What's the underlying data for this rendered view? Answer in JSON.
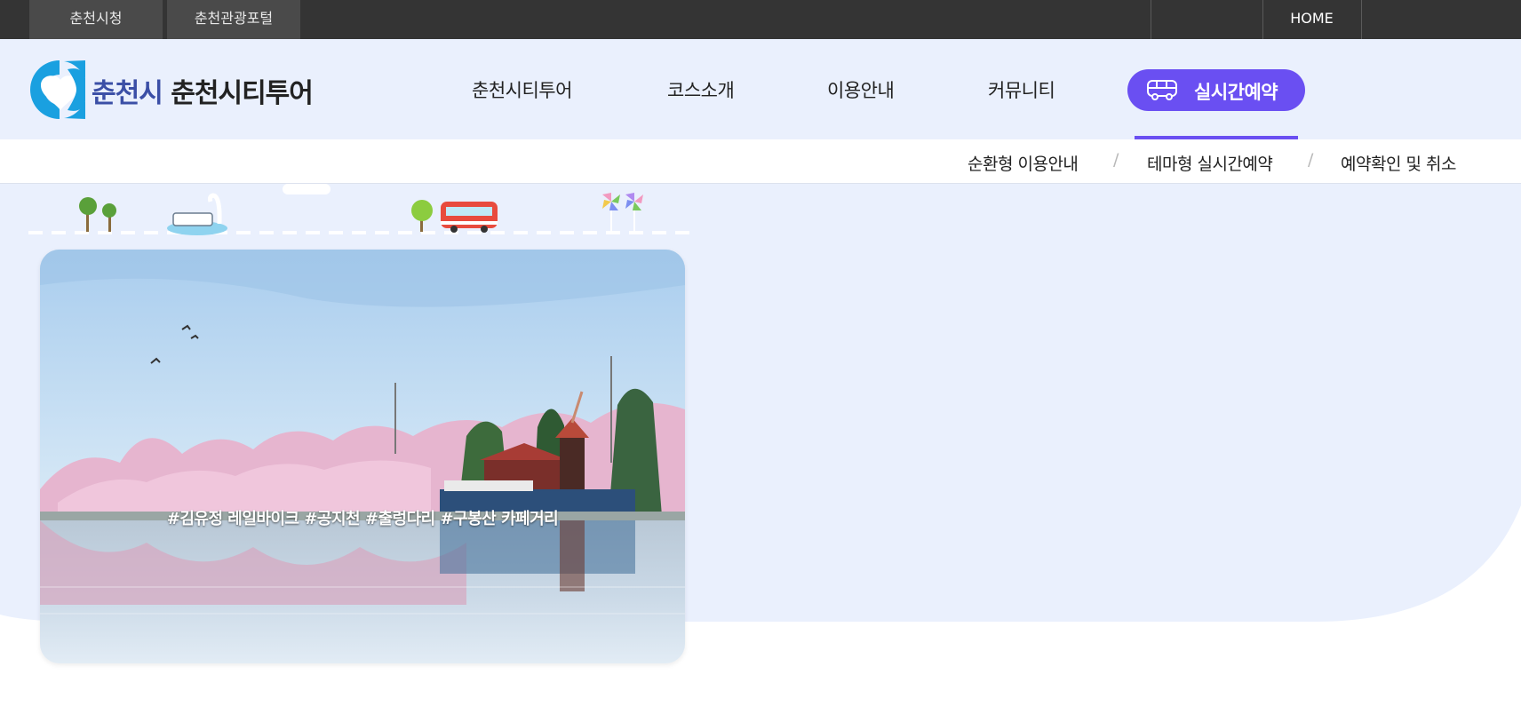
{
  "topbar": {
    "links": [
      "춘천시청",
      "춘천관광포털"
    ],
    "home": "HOME"
  },
  "header": {
    "logo_city": "춘천시",
    "logo_service": "춘천시티투어",
    "nav": [
      "춘천시티투어",
      "코스소개",
      "이용안내",
      "커뮤니티"
    ],
    "reserve_label": "실시간예약"
  },
  "subnav": {
    "items": [
      "순환형 이용안내",
      "테마형 실시간예약",
      "예약확인 및 취소"
    ],
    "separator": "/"
  },
  "main": {
    "card_tags": "#김유정 레일바이크 #공지천 #출렁다리 #구봉산 카페거리"
  },
  "colors": {
    "topbar_bg": "#343434",
    "header_bg": "#eaf0fd",
    "accent": "#6a4ff2",
    "logo_blue": "#1aa0e0"
  },
  "icons": [
    "c-heart-logo-icon",
    "bus-icon",
    "tree-icon",
    "swan-boat-icon",
    "red-bus-icon",
    "pinwheel-icon"
  ]
}
